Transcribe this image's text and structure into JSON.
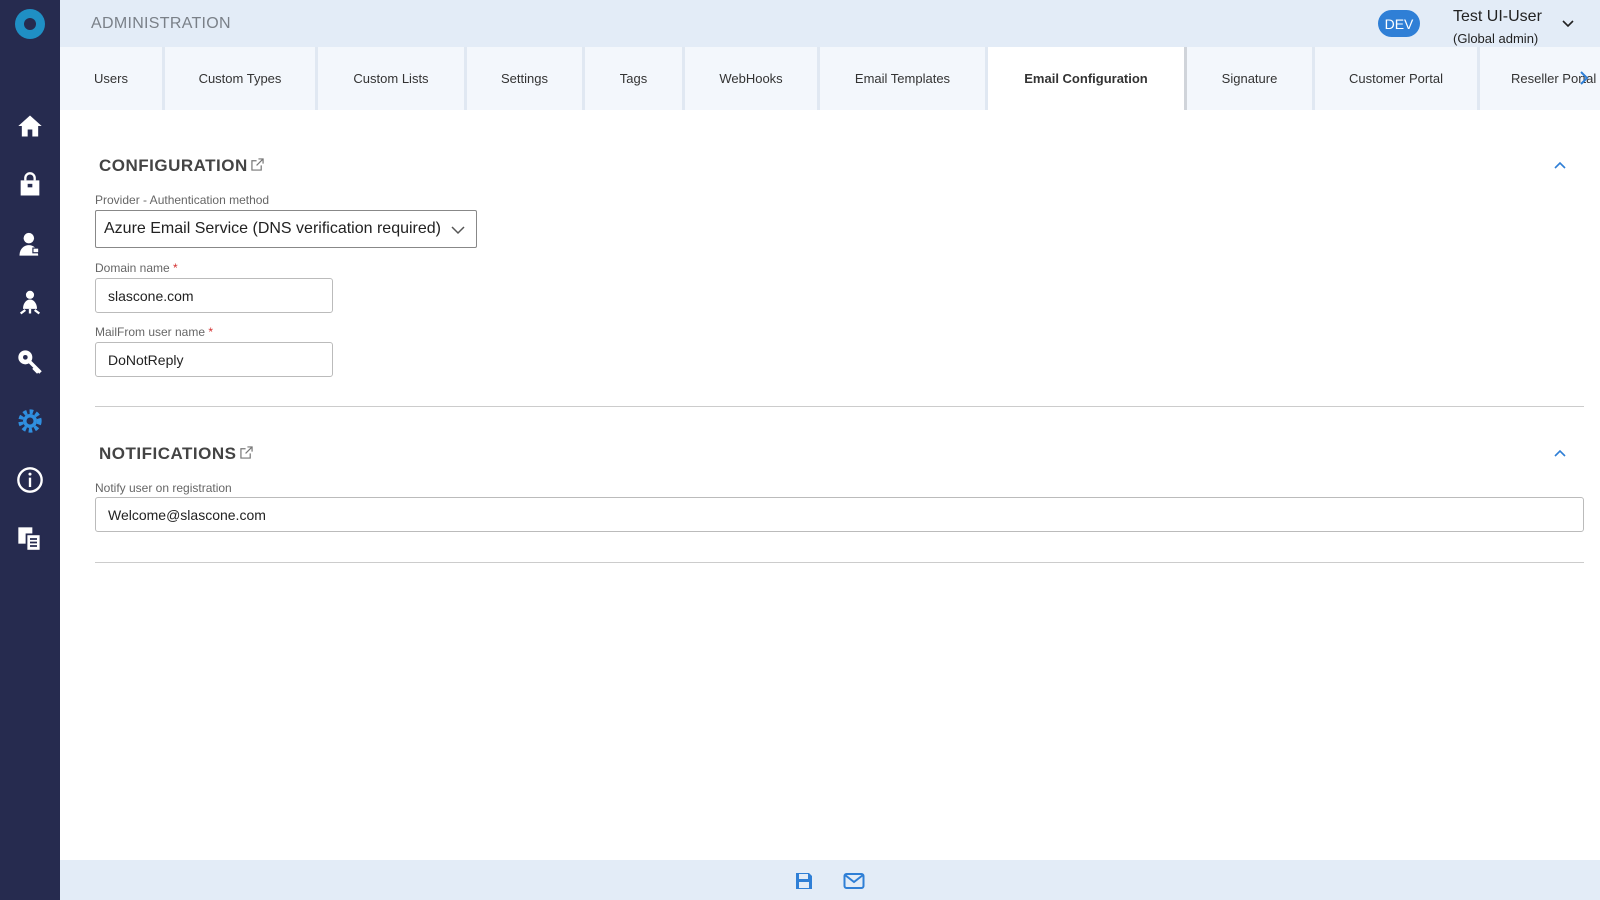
{
  "header": {
    "title": "ADMINISTRATION",
    "env_badge": "DEV",
    "user_name": "Test UI-User",
    "user_role": "(Global admin)"
  },
  "sidebar": {
    "accent": "#1f8fc4",
    "items": [
      {
        "icon": "home-icon"
      },
      {
        "icon": "shopping-bag-icon"
      },
      {
        "icon": "customer-icon"
      },
      {
        "icon": "reseller-icon"
      },
      {
        "icon": "key-icon"
      },
      {
        "icon": "gear-icon",
        "active": true
      },
      {
        "icon": "info-icon"
      },
      {
        "icon": "documents-icon"
      }
    ]
  },
  "tabs": [
    {
      "label": "Users"
    },
    {
      "label": "Custom Types"
    },
    {
      "label": "Custom Lists"
    },
    {
      "label": "Settings"
    },
    {
      "label": "Tags"
    },
    {
      "label": "WebHooks"
    },
    {
      "label": "Email Templates"
    },
    {
      "label": "Email Configuration",
      "active": true
    },
    {
      "label": "Signature"
    },
    {
      "label": "Customer Portal"
    },
    {
      "label": "Reseller Portal"
    }
  ],
  "configuration": {
    "title": "CONFIGURATION",
    "provider_label": "Provider - Authentication method",
    "provider_value": "Azure Email Service (DNS verification required)",
    "domain_label": "Domain name",
    "domain_value": "slascone.com",
    "mailfrom_label": "MailFrom user name",
    "mailfrom_value": "DoNotReply",
    "required_mark": "*"
  },
  "notifications": {
    "title": "NOTIFICATIONS",
    "notify_label": "Notify user on registration",
    "notify_value": "Welcome@slascone.com"
  },
  "footer": {
    "save_icon": "save-icon",
    "email_icon": "envelope-icon"
  },
  "colors": {
    "sidebar_bg": "#262b4f",
    "header_bg": "#e3ecf7",
    "primary": "#2f7fd6"
  }
}
